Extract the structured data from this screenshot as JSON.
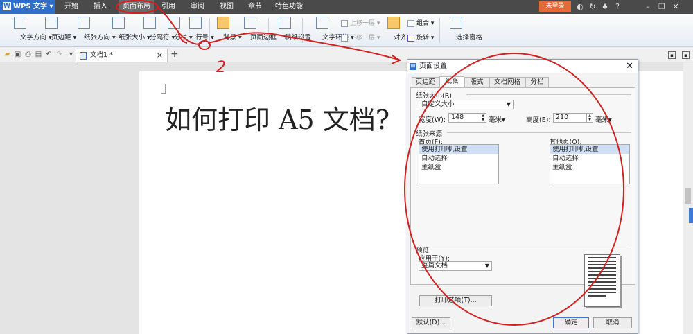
{
  "titlebar": {
    "app_name": "WPS 文字",
    "menu_tabs": [
      "开始",
      "插入",
      "页面布局",
      "引用",
      "审阅",
      "视图",
      "章节",
      "特色功能"
    ],
    "active_tab": "页面布局",
    "login_label": "未登录"
  },
  "ribbon": {
    "buttons": [
      {
        "label": "文字方向 ▾"
      },
      {
        "label": "页边距 ▾"
      },
      {
        "label": "纸张方向 ▾"
      },
      {
        "label": "纸张大小 ▾"
      },
      {
        "label": "分隔符 ▾"
      },
      {
        "label": "分栏 ▾"
      },
      {
        "label": "行号 ▾"
      },
      {
        "label": "背景 ▾"
      },
      {
        "label": "页面边框"
      },
      {
        "label": "稿纸设置"
      },
      {
        "label": "文字环绕 ▾"
      },
      {
        "label": "对齐 ▾"
      },
      {
        "label": "旋转 ▾"
      },
      {
        "label": "选择窗格"
      }
    ],
    "small_buttons": {
      "bring_forward": "上移一层 ▾",
      "send_backward": "下移一层 ▾",
      "group": "组合 ▾"
    }
  },
  "doc_tab": {
    "name": "文档1 *"
  },
  "document": {
    "headline": "如何打印 A5 文档?"
  },
  "dialog": {
    "title": "页面设置",
    "tabs": [
      "页边距",
      "纸张",
      "版式",
      "文档网格",
      "分栏"
    ],
    "active_tab": "纸张",
    "paper_size": {
      "group_label": "纸张大小(R)",
      "selected": "自定义大小",
      "width_label": "宽度(W):",
      "width_value": "148",
      "width_unit": "毫米▾",
      "height_label": "高度(E):",
      "height_value": "210",
      "height_unit": "毫米▾"
    },
    "paper_source": {
      "group_label": "纸张来源",
      "first_page_label": "首页(F):",
      "other_pages_label": "其他页(O):",
      "options": [
        "使用打印机设置",
        "自动选择",
        "主纸盒"
      ],
      "first_page_selected": "使用打印机设置",
      "other_pages_selected": "使用打印机设置"
    },
    "preview": {
      "group_label": "预览",
      "apply_to_label": "应用于(Y):",
      "apply_to_value": "整篇文档",
      "print_options_label": "打印选项(T)..."
    },
    "buttons": {
      "default": "默认(D)...",
      "ok": "确定",
      "cancel": "取消"
    }
  },
  "annotations": {
    "step_number": "2"
  },
  "colors": {
    "accent": "#2f6fc9",
    "annotation": "#d21f1f",
    "login": "#e46a3a"
  }
}
